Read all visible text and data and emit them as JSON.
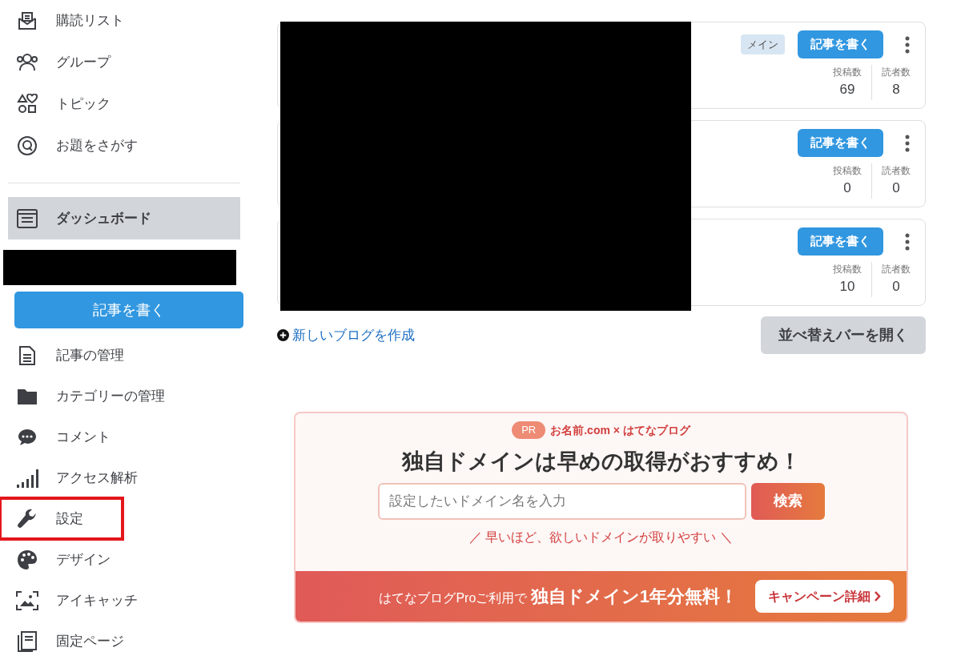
{
  "sidebar": {
    "top_items": [
      {
        "kind": "subscriptions",
        "label": "購読リスト"
      },
      {
        "kind": "groups",
        "label": "グループ"
      },
      {
        "kind": "topics",
        "label": "トピック"
      },
      {
        "kind": "themes",
        "label": "お題をさがす"
      }
    ],
    "dashboard": {
      "label": "ダッシュボード",
      "selected": true
    },
    "write_button": "記事を書く",
    "blog_items": [
      {
        "kind": "articles",
        "label": "記事の管理",
        "highlighted": false
      },
      {
        "kind": "categories",
        "label": "カテゴリーの管理",
        "highlighted": false
      },
      {
        "kind": "comments",
        "label": "コメント",
        "highlighted": false
      },
      {
        "kind": "analytics",
        "label": "アクセス解析",
        "highlighted": false
      },
      {
        "kind": "settings",
        "label": "設定",
        "highlighted": true
      },
      {
        "kind": "design",
        "label": "デザイン",
        "highlighted": false
      },
      {
        "kind": "eyecatch",
        "label": "アイキャッチ",
        "highlighted": false
      },
      {
        "kind": "pages",
        "label": "固定ページ",
        "highlighted": false
      }
    ]
  },
  "blogs": [
    {
      "badge": "メイン",
      "write_button": "記事を書く",
      "posts_label": "投稿数",
      "posts": "69",
      "readers_label": "読者数",
      "readers": "8"
    },
    {
      "write_button": "記事を書く",
      "posts_label": "投稿数",
      "posts": "0",
      "readers_label": "読者数",
      "readers": "0"
    },
    {
      "write_button": "記事を書く",
      "posts_label": "投稿数",
      "posts": "10",
      "readers_label": "読者数",
      "readers": "0"
    }
  ],
  "create_blog_link": "新しいブログを作成",
  "sort_button": "並べ替えバーを開く",
  "promo": {
    "pr_badge": "PR",
    "sponsor": "お名前.com × はてなブログ",
    "headline": "独自ドメインは早めの取得がおすすめ！",
    "search": {
      "placeholder": "設定したいドメイン名を入力"
    },
    "search_button": "検索",
    "note": "／ 早いほど、欲しいドメインが取りやすい ＼",
    "banner_text": "はてなブログProご利用で",
    "banner_emphasis": "独自ドメイン1年分無料！",
    "campaign_button": "キャンペーン詳細"
  }
}
